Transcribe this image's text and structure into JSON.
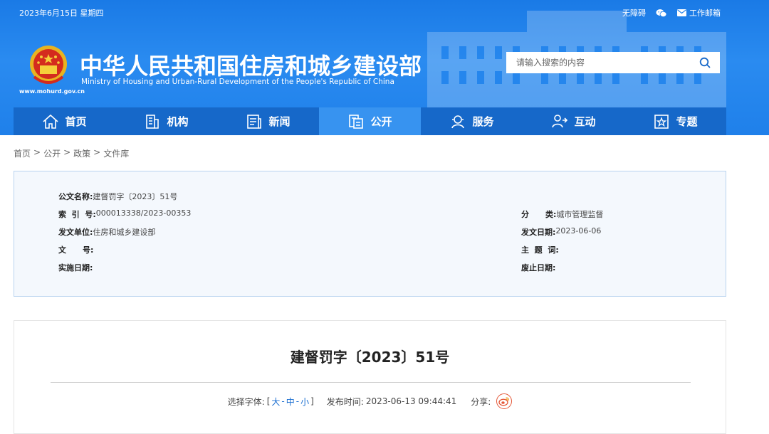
{
  "topbar": {
    "date": "2023年6月15日 星期四",
    "accessibility": "无障碍",
    "wechat_icon": "wechat-icon",
    "mail_icon": "mail-icon",
    "mail_label": "工作邮箱"
  },
  "header": {
    "title": "中华人民共和国住房和城乡建设部",
    "subtitle": "Ministry of Housing and Urban-Rural Development of the People's Republic of China",
    "url": "www.mohurd.gov.cn",
    "brand_color": "#1f80ea"
  },
  "search": {
    "placeholder": "请输入搜索的内容",
    "icon": "search-icon"
  },
  "nav": {
    "items": [
      {
        "label": "首页",
        "icon": "home-icon"
      },
      {
        "label": "机构",
        "icon": "building-icon"
      },
      {
        "label": "新闻",
        "icon": "news-icon"
      },
      {
        "label": "公开",
        "icon": "document-icon",
        "active": true
      },
      {
        "label": "服务",
        "icon": "service-icon"
      },
      {
        "label": "互动",
        "icon": "interaction-icon"
      },
      {
        "label": "专题",
        "icon": "star-icon"
      }
    ]
  },
  "breadcrumb": [
    "首页",
    "公开",
    "政策",
    "文件库"
  ],
  "meta": {
    "doc_name_label": "公文名称:",
    "doc_name": "建督罚字〔2023〕51号",
    "index_label": "索  引  号:",
    "index": "000013338/2023-00353",
    "category_label": "分      类:",
    "category": "城市管理监督",
    "issuer_label": "发文单位:",
    "issuer": "住房和城乡建设部",
    "issue_date_label": "发文日期:",
    "issue_date": "2023-06-06",
    "doc_no_label": "文      号:",
    "doc_no": "",
    "keywords_label": "主  题  词:",
    "keywords": "",
    "effective_label": "实施日期:",
    "effective": "",
    "expiry_label": "废止日期:",
    "expiry": ""
  },
  "article": {
    "title": "建督罚字〔2023〕51号",
    "font_select_label": "选择字体:",
    "bracket_open": "[",
    "size_large": "大",
    "size_medium": "中",
    "size_small": "小",
    "dash": "-",
    "bracket_close": "]",
    "publish_label": "发布时间:",
    "publish_time": "2023-06-13 09:44:41",
    "share_label": "分享:",
    "share_icon": "weibo-icon"
  }
}
